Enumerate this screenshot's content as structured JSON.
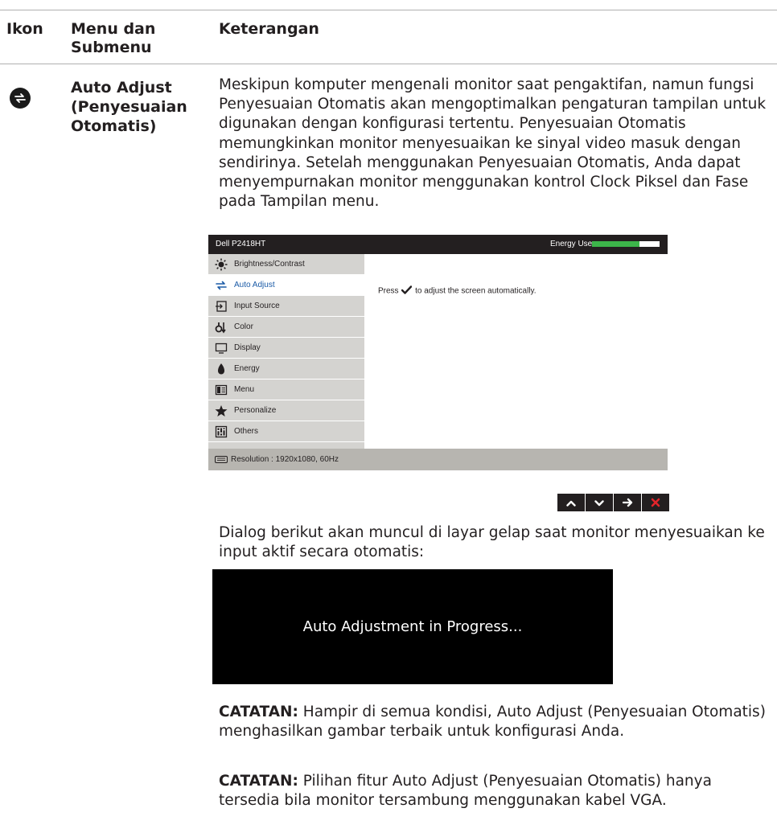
{
  "table": {
    "headers": {
      "icon": "Ikon",
      "menu": "Menu dan Submenu",
      "description": "Keterangan"
    },
    "row": {
      "icon_name": "auto-adjust-icon",
      "title": "Auto Adjust (Penyesuaian Otomatis)",
      "description": "Meskipun komputer mengenali monitor saat pengaktifan, namun fungsi Penyesuaian Otomatis akan mengoptimalkan pengaturan tampilan untuk digunakan dengan konfigurasi tertentu. Penyesuaian Otomatis memungkinkan monitor menyesuaikan ke sinyal video masuk dengan sendirinya. Setelah menggunakan Penyesuaian Otomatis, Anda dapat menyempurnakan monitor menggunakan kontrol Clock Piksel dan Fase pada Tampilan menu."
    }
  },
  "osd": {
    "model": "Dell P2418HT",
    "energy_label": "Energy Use",
    "energy_level": 0.7,
    "menu_items": [
      {
        "label": "Brightness/Contrast",
        "icon": "brightness-icon",
        "active": false
      },
      {
        "label": "Auto Adjust",
        "icon": "auto-adjust-icon",
        "active": true
      },
      {
        "label": "Input Source",
        "icon": "input-source-icon",
        "active": false
      },
      {
        "label": "Color",
        "icon": "color-icon",
        "active": false
      },
      {
        "label": "Display",
        "icon": "display-icon",
        "active": false
      },
      {
        "label": "Energy",
        "icon": "energy-icon",
        "active": false
      },
      {
        "label": "Menu",
        "icon": "menu-icon",
        "active": false
      },
      {
        "label": "Personalize",
        "icon": "star-icon",
        "active": false
      },
      {
        "label": "Others",
        "icon": "others-icon",
        "active": false
      }
    ],
    "message_prefix": "Press",
    "message_suffix": "to adjust the screen automatically.",
    "resolution": "Resolution : 1920x1080, 60Hz"
  },
  "nav_buttons": [
    {
      "icon": "chevron-up-icon"
    },
    {
      "icon": "chevron-down-icon"
    },
    {
      "icon": "arrow-right-icon"
    },
    {
      "icon": "close-icon",
      "color": "#e3242b"
    }
  ],
  "dialog_intro": "Dialog berikut akan muncul di layar gelap saat monitor menyesuaikan ke input aktif secara otomatis:",
  "dialog_text": "Auto Adjustment in Progress...",
  "notes": [
    {
      "label": "CATATAN:",
      "text": " Hampir di semua kondisi, Auto Adjust (Penyesuaian Otomatis) menghasilkan gambar terbaik untuk konfigurasi Anda."
    },
    {
      "label": "CATATAN:",
      "text": " Pilihan fitur Auto Adjust (Penyesuaian Otomatis) hanya tersedia bila monitor tersambung menggunakan kabel VGA."
    }
  ],
  "colors": {
    "osd_title_bar": "#231f20",
    "osd_menu_bg": "#d4d3d0",
    "energy_fill": "#3cb54a",
    "active_label": "#1a5aa6"
  }
}
